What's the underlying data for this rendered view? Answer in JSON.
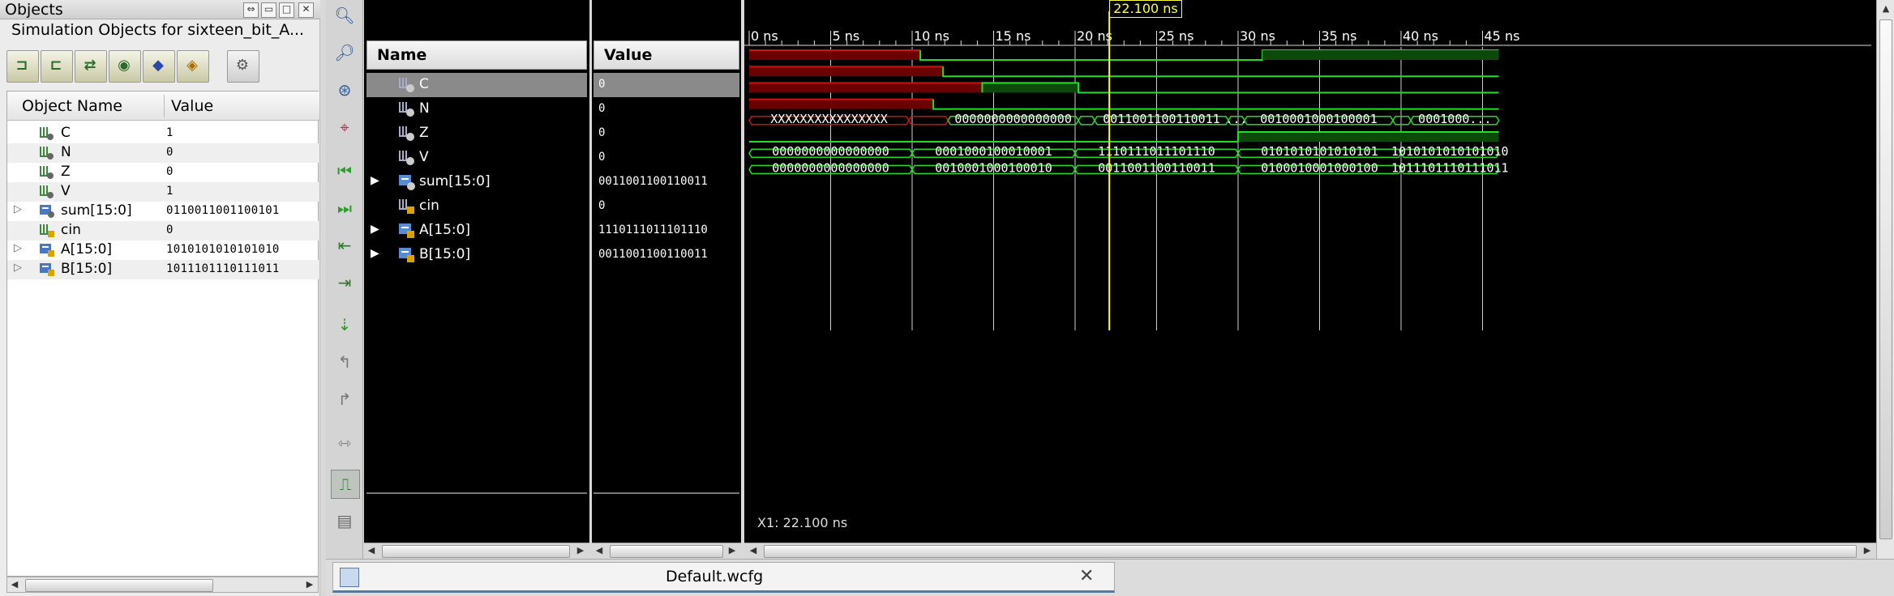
{
  "objects_panel": {
    "title": "Objects",
    "subtitle": "Simulation Objects for sixteen_bit_A...",
    "columns": {
      "name": "Object Name",
      "value": "Value"
    },
    "toolbar_icons": [
      "input-filter-icon",
      "output-filter-icon",
      "bidir-filter-icon",
      "internal-filter-icon",
      "constant-filter-icon",
      "variable-filter-icon",
      "settings-icon"
    ],
    "rows": [
      {
        "name": "C",
        "value": "1",
        "expandable": false
      },
      {
        "name": "N",
        "value": "0",
        "expandable": false
      },
      {
        "name": "Z",
        "value": "0",
        "expandable": false
      },
      {
        "name": "V",
        "value": "1",
        "expandable": false
      },
      {
        "name": "sum[15:0]",
        "value": "0110011001100101",
        "expandable": true
      },
      {
        "name": "cin",
        "value": "0",
        "expandable": false
      },
      {
        "name": "A[15:0]",
        "value": "1010101010101010",
        "expandable": true
      },
      {
        "name": "B[15:0]",
        "value": "1011101110111011",
        "expandable": true
      }
    ]
  },
  "wave": {
    "name_header": "Name",
    "value_header": "Value",
    "signals": [
      {
        "name": "C",
        "value": "0",
        "expandable": false,
        "selected": true
      },
      {
        "name": "N",
        "value": "0",
        "expandable": false,
        "selected": false
      },
      {
        "name": "Z",
        "value": "0",
        "expandable": false,
        "selected": false
      },
      {
        "name": "V",
        "value": "0",
        "expandable": false,
        "selected": false
      },
      {
        "name": "sum[15:0]",
        "value": "0011001100110011",
        "expandable": true,
        "selected": false
      },
      {
        "name": "cin",
        "value": "0",
        "expandable": false,
        "selected": false
      },
      {
        "name": "A[15:0]",
        "value": "1110111011101110",
        "expandable": true,
        "selected": false
      },
      {
        "name": "B[15:0]",
        "value": "0011001100110011",
        "expandable": true,
        "selected": false
      }
    ],
    "time_ticks": [
      "0 ns",
      "5 ns",
      "10 ns",
      "15 ns",
      "20 ns",
      "25 ns",
      "30 ns",
      "35 ns",
      "40 ns",
      "45 ns"
    ],
    "cursor_label": "22.100 ns",
    "cursor_time_ns": 22.1,
    "x1_readout": "X1: 22.100 ns",
    "bus_labels": {
      "sum": [
        "XXXXXXXXXXXXXXXX",
        "0000000000000000",
        "0011001100110011",
        "...",
        "0010001000100001",
        "0001000..."
      ],
      "A": [
        "0000000000000000",
        "0001000100010001",
        "1110111011101110",
        "0101010101010101",
        "1010101010101010"
      ],
      "B": [
        "0000000000000000",
        "0010001000100010",
        "0011001100110011",
        "0100010001000100",
        "1011101110111011"
      ]
    },
    "colors": {
      "valid": "#22dd22",
      "undefined": "#cc1111",
      "cursor": "#ffff33",
      "grid": "#cfcfcf"
    }
  },
  "tab": {
    "label": "Default.wcfg"
  }
}
